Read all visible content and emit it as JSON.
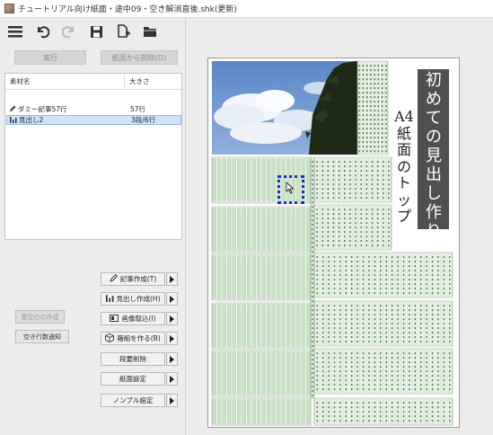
{
  "window": {
    "title": "チュートリアル向け紙面・途中09・空き解消直後.shk(更新)"
  },
  "toolbar": {
    "icons": [
      "menu-icon",
      "undo-icon",
      "redo-icon",
      "save-icon",
      "new-page-icon",
      "open-folder-icon"
    ]
  },
  "top_buttons": {
    "run": "実行",
    "remove_from_page": "紙面から削除(D)"
  },
  "material_table": {
    "headers": {
      "name": "素材名",
      "size": "大きさ"
    },
    "rows": [
      {
        "icon": "pencil-icon",
        "name": "ダミー記事57行",
        "size": "57行",
        "selected": false
      },
      {
        "icon": "chart-icon",
        "name": "見出し2",
        "size": "3段/6行",
        "selected": true
      }
    ]
  },
  "left_buttons": {
    "resolve_whitespace": "重空白の作成",
    "blank_line_notice": "空き行数通知"
  },
  "action_buttons": [
    {
      "icon": "pencil-icon",
      "label": "記事作成(T)"
    },
    {
      "icon": "chart-icon",
      "label": "見出し作成(H)"
    },
    {
      "icon": "image-icon",
      "label": "画像取込(I)"
    },
    {
      "icon": "box-icon",
      "label": "箱組を作る(B)"
    },
    {
      "icon": "",
      "label": "段要削除"
    },
    {
      "icon": "",
      "label": "紙面設定"
    },
    {
      "icon": "",
      "label": "ノンブル設定"
    }
  ],
  "page": {
    "headline": "初めての見出し作り",
    "subheadline": "A4紙面のトップ"
  },
  "colors": {
    "column_green": "#c8e2c4",
    "selection_blue": "#1830c8",
    "headline_bg": "#505050"
  }
}
